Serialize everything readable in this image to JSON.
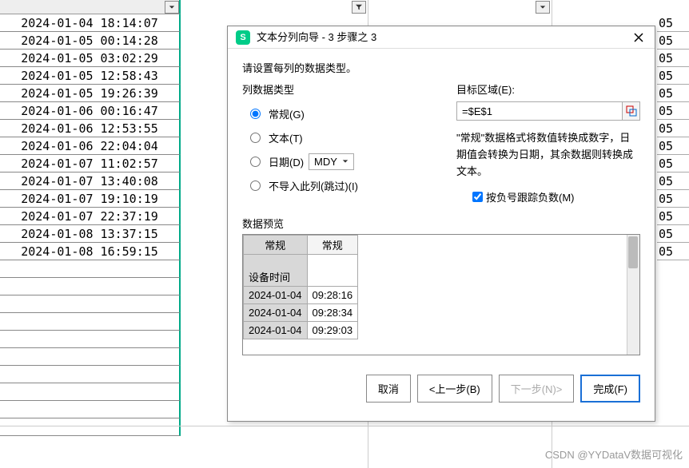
{
  "spreadsheet": {
    "col_a": [
      "2024-01-04 18:14:07",
      "2024-01-05 00:14:28",
      "2024-01-05 03:02:29",
      "2024-01-05 12:58:43",
      "2024-01-05 19:26:39",
      "2024-01-06 00:16:47",
      "2024-01-06 12:53:55",
      "2024-01-06 22:04:04",
      "2024-01-07 11:02:57",
      "2024-01-07 13:40:08",
      "2024-01-07 19:10:19",
      "2024-01-07 22:37:19",
      "2024-01-08 13:37:15",
      "2024-01-08 16:59:15"
    ],
    "right_vals": [
      "05",
      "05",
      "05",
      "05",
      "05",
      "05",
      "05",
      "05",
      "05",
      "05",
      "05",
      "05",
      "05",
      "05"
    ]
  },
  "dialog": {
    "title": "文本分列向导 - 3 步骤之 3",
    "instruction": "请设置每列的数据类型。",
    "col_type_label": "列数据类型",
    "radios": {
      "general": "常规(G)",
      "text": "文本(T)",
      "date": "日期(D)",
      "skip": "不导入此列(跳过)(I)"
    },
    "mdy": "MDY",
    "target_label": "目标区域(E):",
    "target_value": "=$E$1",
    "desc": "\"常规\"数据格式将数值转换成数字，日期值会转换为日期，其余数据则转换成文本。",
    "chk_label": "按负号跟踪负数(M)",
    "preview_label": "数据预览",
    "preview_headers": [
      "常规",
      "常规"
    ],
    "preview_col1_header": "设备时间",
    "preview_rows": [
      [
        "2024-01-04",
        "09:28:16"
      ],
      [
        "2024-01-04",
        "09:28:34"
      ],
      [
        "2024-01-04",
        "09:29:03"
      ]
    ],
    "buttons": {
      "cancel": "取消",
      "back": "<上一步(B)",
      "next": "下一步(N)>",
      "finish": "完成(F)"
    }
  },
  "watermark": "CSDN @YYDataV数据可视化"
}
